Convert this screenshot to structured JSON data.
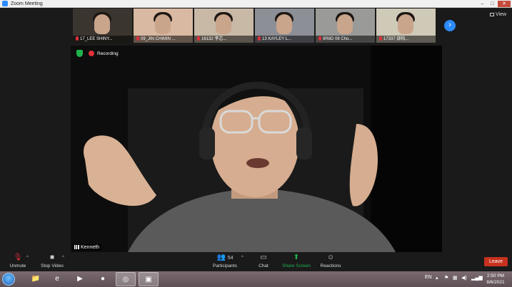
{
  "window": {
    "title": "Zoom Meeting",
    "controls": [
      "–",
      "□",
      "✕"
    ]
  },
  "gallery": {
    "participants": [
      {
        "name": "17_LEE SHINY...",
        "bg": "#3b3530"
      },
      {
        "name": "09_JIN CHIMIN ...",
        "bg": "#d9b9a2"
      },
      {
        "name": "16132 李芯...",
        "bg": "#c8b9a7"
      },
      {
        "name": "13 KAYLEY L...",
        "bg": "#8c8f96"
      },
      {
        "name": "9R8D 08 Cho...",
        "bg": "#9a9a98"
      },
      {
        "name": "17337 邵柏...",
        "bg": "#cfc9b8"
      }
    ],
    "next_icon": "chevron-right-icon",
    "view_label": "View"
  },
  "speaker": {
    "name": "Kenneth",
    "recording_label": "Recording"
  },
  "toolbar": {
    "unmute": "Unmute",
    "stop_video": "Stop Video",
    "participants": "Participants",
    "participant_count": "54",
    "chat": "Chat",
    "share_screen": "Share Screen",
    "reactions": "Reactions",
    "leave": "Leave"
  },
  "taskbar": {
    "language": "EN",
    "time": "2:50 PM",
    "date": "8/6/2021"
  },
  "colors": {
    "accent_blue": "#2d8cff",
    "share_green": "#1fb34d",
    "leave_red": "#c6321e",
    "record_red": "#e0303a"
  }
}
